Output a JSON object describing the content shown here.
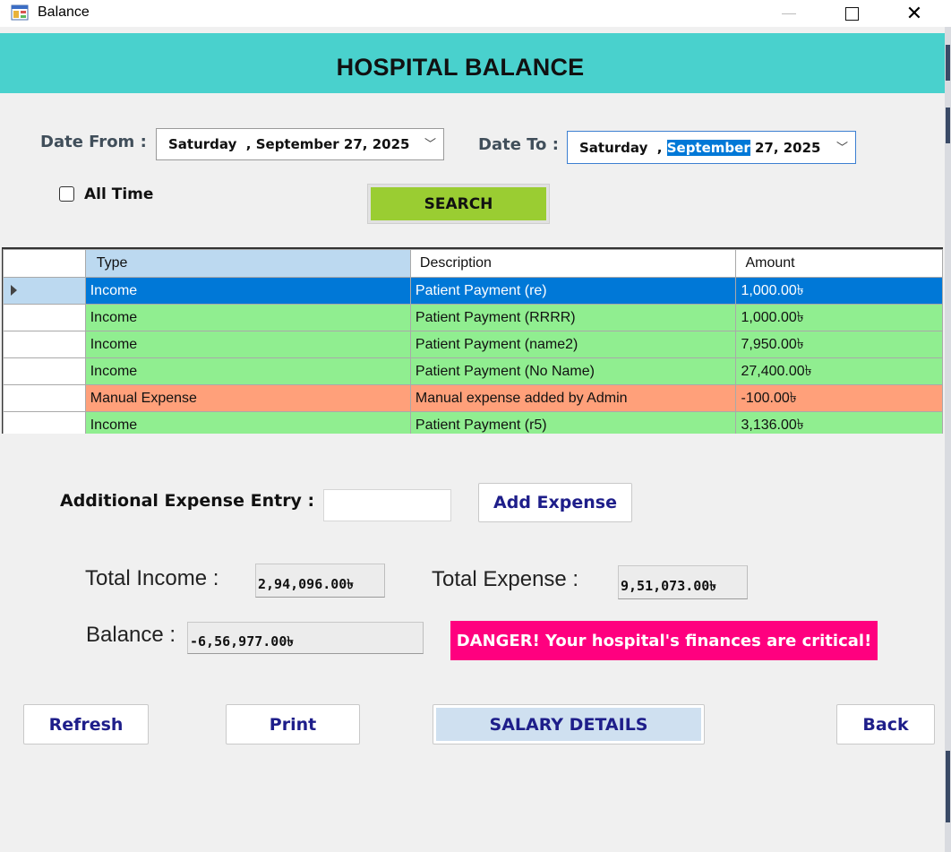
{
  "window": {
    "title": "Balance",
    "app_icon": "winforms-app-icon",
    "controls": [
      "minimize-icon",
      "maximize-icon",
      "close-icon"
    ],
    "close_glyph": "✕"
  },
  "header": {
    "title": "HOSPITAL BALANCE",
    "bg_color": "#49d1cd"
  },
  "filters": {
    "date_from_label": "Date From :",
    "date_from_value": "Saturday  , September 27, 2025",
    "date_to_label": "Date To :",
    "date_to_weekday": "Saturday  , ",
    "date_to_selected": "September",
    "date_to_rest": " 27, 2025",
    "dropdown_glyph": "﹀",
    "all_time_label": "All Time",
    "all_time_checked": false,
    "search_label": "SEARCH",
    "search_color": "#9acd32"
  },
  "grid": {
    "columns": [
      "Type",
      "Description",
      "Amount"
    ],
    "rows": [
      {
        "type": "Income",
        "description": "Patient Payment (re)",
        "amount": "1,000.00৳",
        "status": "selected"
      },
      {
        "type": "Income",
        "description": "Patient Payment (RRRR)",
        "amount": "1,000.00৳",
        "status": "income"
      },
      {
        "type": "Income",
        "description": "Patient Payment (name2)",
        "amount": "7,950.00৳",
        "status": "income"
      },
      {
        "type": "Income",
        "description": "Patient Payment (No Name)",
        "amount": "27,400.00৳",
        "status": "income"
      },
      {
        "type": "Manual Expense",
        "description": "Manual expense added by Admin",
        "amount": "-100.00৳",
        "status": "expense"
      },
      {
        "type": "Income",
        "description": "Patient Payment (r5)",
        "amount": "3,136.00৳",
        "status": "income"
      }
    ],
    "colors": {
      "income": "#90ee90",
      "expense": "#ffa07a",
      "selected": "#0078d7"
    }
  },
  "expense_entry": {
    "label": "Additional Expense Entry :",
    "value": "",
    "button_label": "Add Expense"
  },
  "totals": {
    "income_label": "Total Income :",
    "income_value": "2,94,096.00৳",
    "expense_label": "Total Expense :",
    "expense_value": "9,51,073.00৳",
    "balance_label": "Balance :",
    "balance_value": "-6,56,977.00৳",
    "alert_text": "DANGER! Your hospital's finances are critical!",
    "alert_color": "#ff007f"
  },
  "actions": {
    "refresh": "Refresh",
    "print": "Print",
    "salary": "SALARY DETAILS",
    "back": "Back"
  }
}
